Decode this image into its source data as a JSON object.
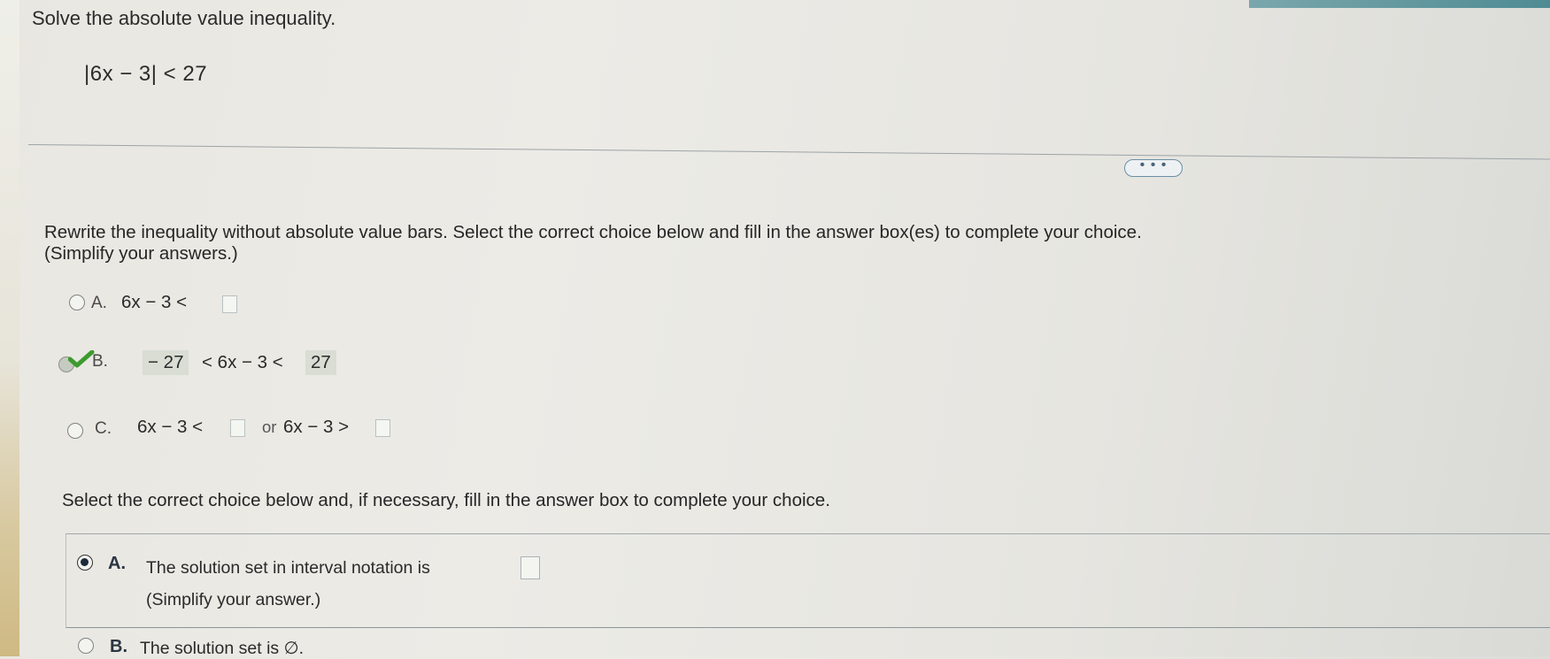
{
  "question": {
    "title": "Solve the absolute value inequality.",
    "equation": "|6x − 3| < 27"
  },
  "more_button": {
    "label": "• • •",
    "icon": "more-dots-icon"
  },
  "part1": {
    "instruction": "Rewrite the inequality without absolute value bars. Select the correct choice below and fill in the answer box(es) to complete your choice.",
    "simplify_note": "(Simplify your answers.)",
    "options": [
      {
        "letter": "A.",
        "expr_left": "6x − 3 <",
        "state": "unselected"
      },
      {
        "letter": "B.",
        "box1_value": "− 27",
        "expr_middle": "< 6x − 3 <",
        "box2_value": "27",
        "state": "correct",
        "icon": "checkmark-icon"
      },
      {
        "letter": "C.",
        "expr_left": "6x − 3 <",
        "connector": "or",
        "expr_right": "6x − 3 >",
        "state": "unselected"
      }
    ]
  },
  "part2": {
    "instruction": "Select the correct choice below and, if necessary, fill in the answer box to complete your choice.",
    "options": [
      {
        "letter": "A.",
        "text": "The solution set in interval notation is",
        "note": "(Simplify your answer.)",
        "state": "selected",
        "input_value": ""
      },
      {
        "letter": "B.",
        "text": "The solution set is ∅.",
        "state": "unselected"
      }
    ]
  },
  "colors": {
    "accent": "#4f8b93",
    "check_green": "#3d9a2f",
    "filled_box": "#d9ddd4"
  }
}
